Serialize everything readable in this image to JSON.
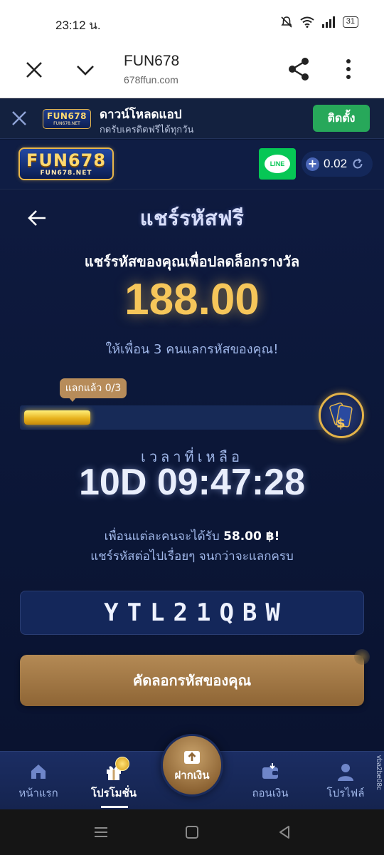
{
  "status_bar": {
    "time": "23:12 น.",
    "battery": "31"
  },
  "browser": {
    "title": "FUN678",
    "url": "678ffun.com"
  },
  "download_banner": {
    "logo_text": "FUN678",
    "logo_sub": "FUN678.NET",
    "title": "ดาวน์โหลดแอป",
    "subtitle": "กดรับเครดิตฟรีได้ทุกวัน",
    "install_label": "ติดตั้ง"
  },
  "header": {
    "logo_text": "FUN678",
    "logo_sub": "FUN678.NET",
    "line_label": "LINE",
    "balance": "0.02"
  },
  "page": {
    "title": "แชร์รหัสฟรี",
    "headline": "แชร์รหัสของคุณเพื่อปลดล็อกรางวัล",
    "amount": "188.00",
    "invite_text": "ให้เพื่อน 3 คนแลกรหัสของคุณ!",
    "progress_label": "แลกแล้ว 0/3",
    "progress_fraction": 0.21,
    "time_left_label": "เวลาที่เหลือ",
    "countdown": "10D 09:47:28",
    "info_prefix": "เพื่อนแต่ละคนจะได้รับ ",
    "info_amount": "58.00 ฿!",
    "info_line2": "แชร์รหัสต่อไปเรื่อยๆ จนกว่าจะแลกครบ",
    "code": "YTL21QBW",
    "copy_button": "คัดลอกรหัสของคุณ"
  },
  "bottom_nav": {
    "home": "หน้าแรก",
    "promotion": "โปรโมชั่น",
    "deposit": "ฝากเงิน",
    "withdraw": "ถอนเงิน",
    "profile": "โปรไฟล์"
  },
  "side_text": "vba2be08c",
  "colors": {
    "background": "#0c1735",
    "gold": "#f6c65a",
    "button_bronze": "#a57b47",
    "install_green": "#27a85a",
    "line_green": "#06c755"
  },
  "icons": {
    "close": "close-icon",
    "chevron": "chevron-down-icon",
    "share": "share-icon",
    "more": "more-vert-icon",
    "back": "arrow-left-icon",
    "refresh": "refresh-icon",
    "reward": "money-card-icon",
    "home": "home-icon",
    "gift": "gift-icon",
    "wallet": "wallet-icon",
    "user": "user-icon"
  }
}
